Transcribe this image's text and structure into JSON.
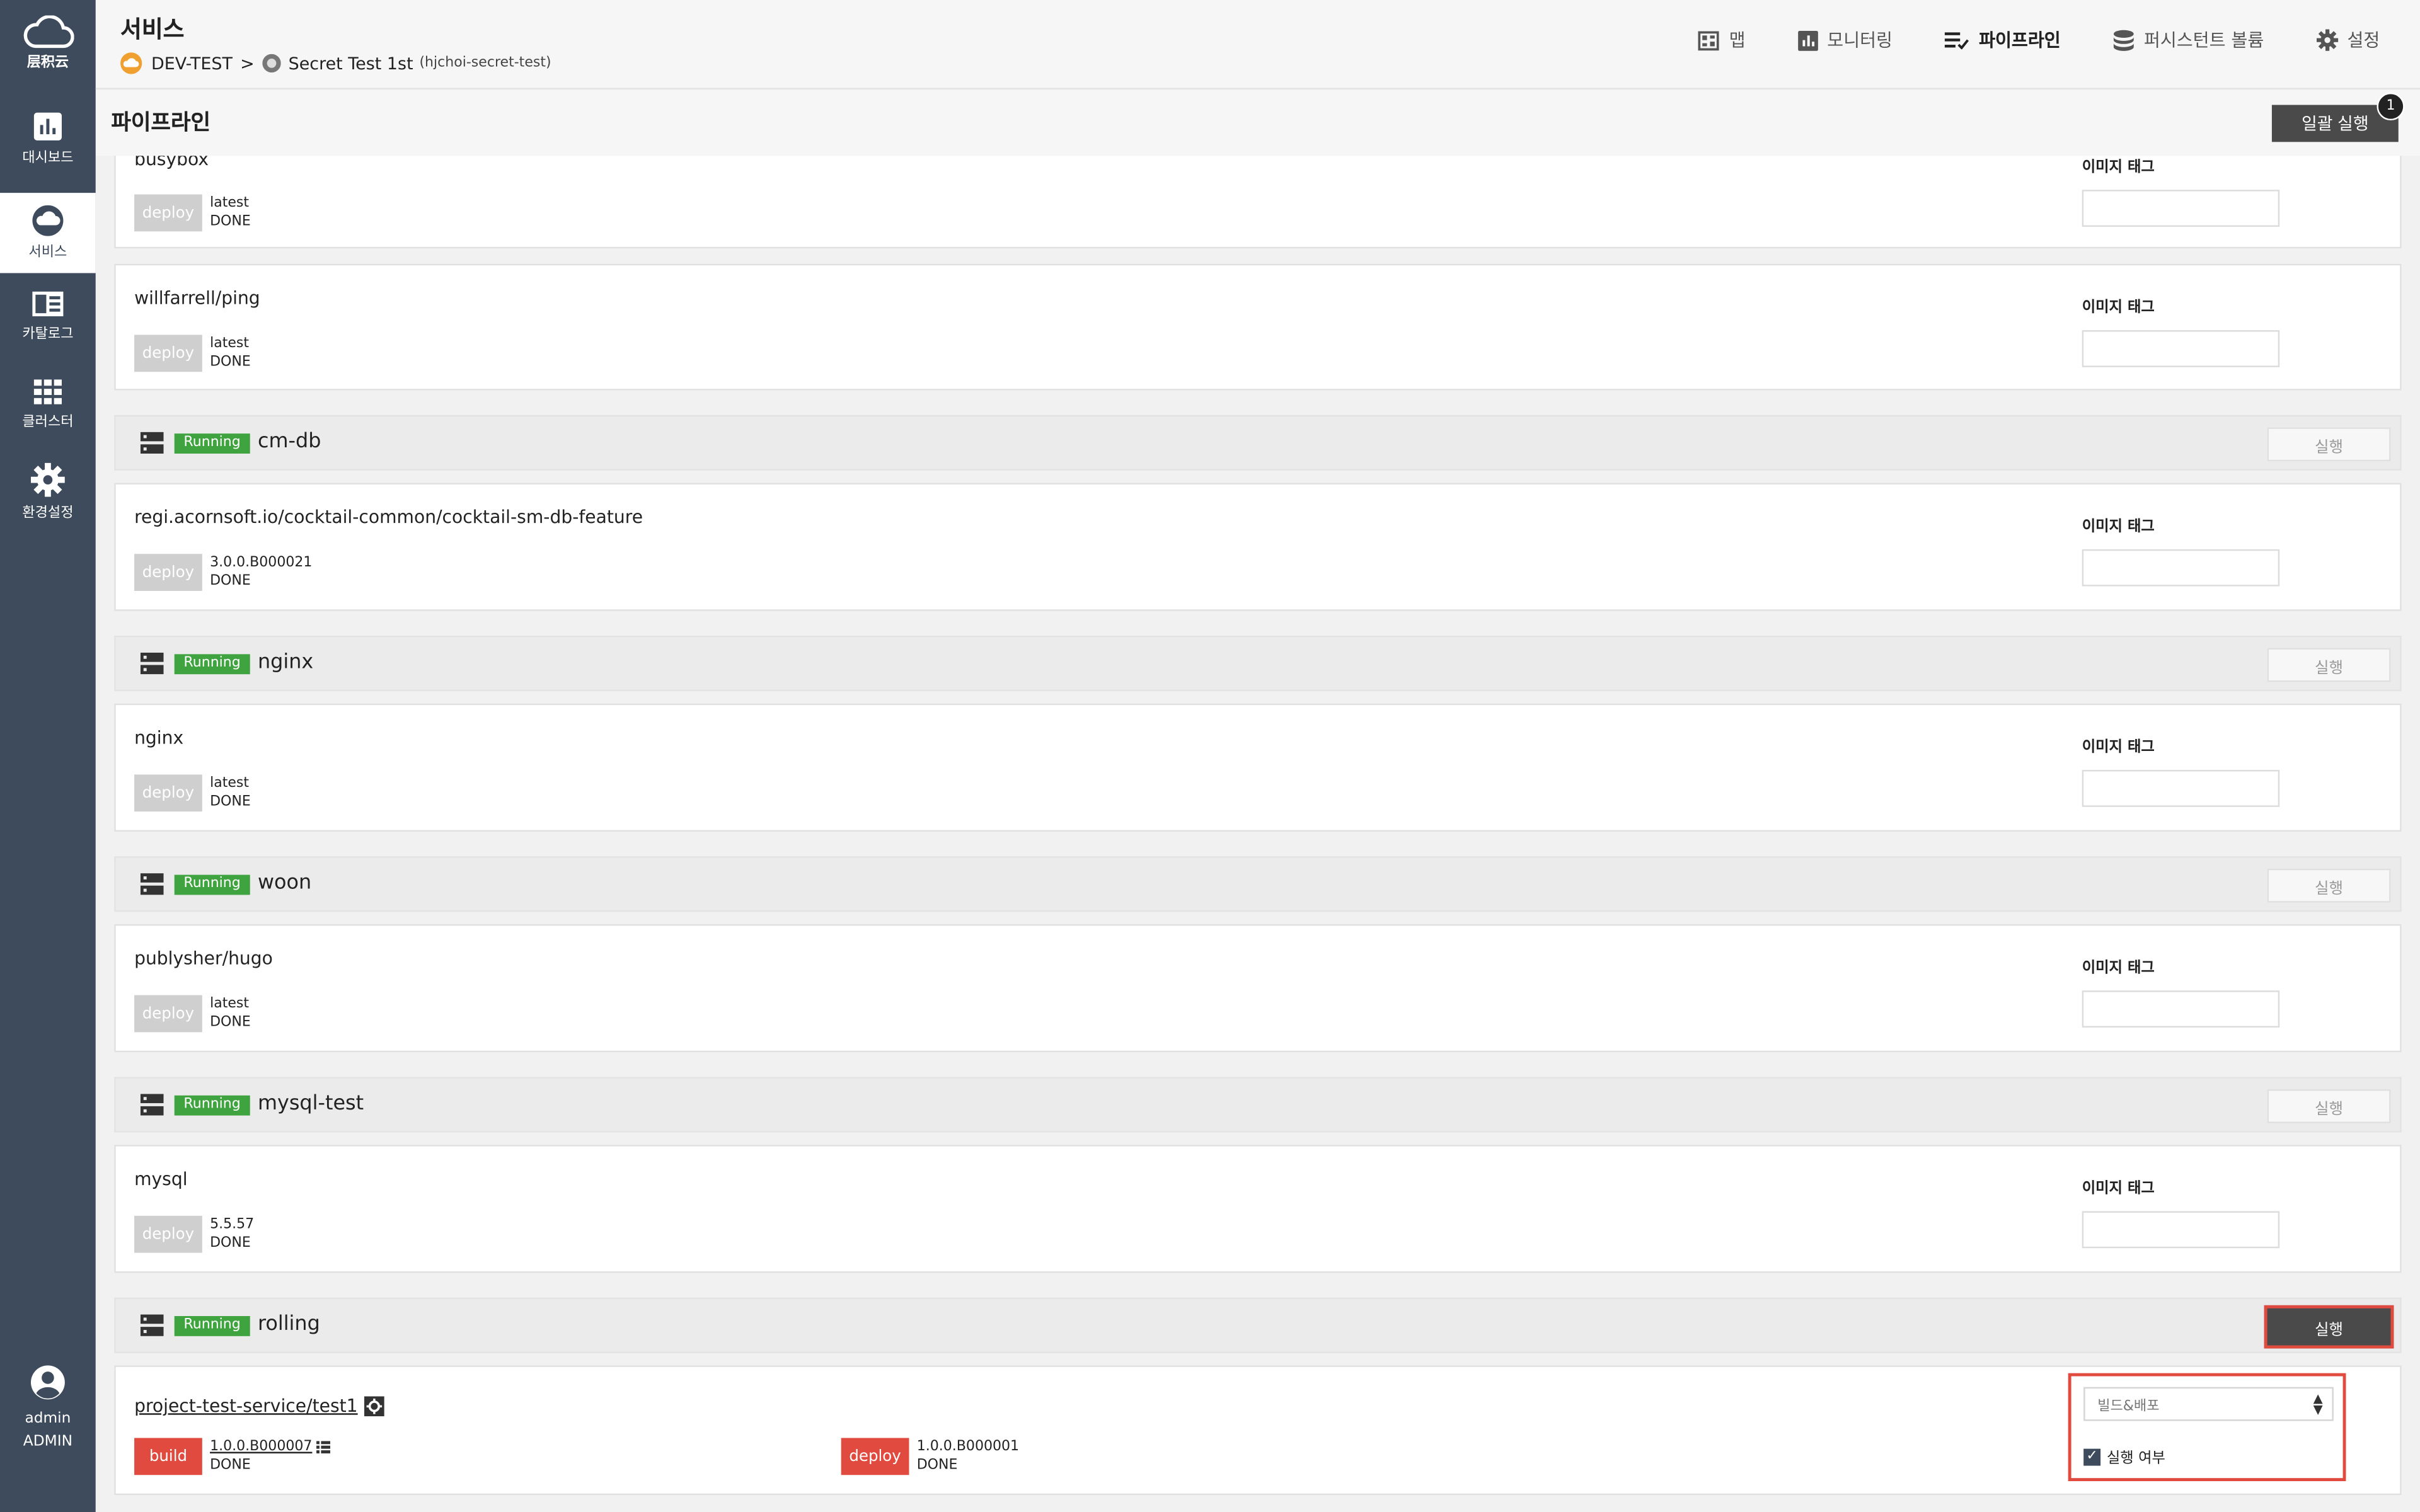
{
  "sidebar": {
    "logo_text": "层积云",
    "items": [
      {
        "label": "대시보드",
        "icon": "bar-chart-icon"
      },
      {
        "label": "서비스",
        "icon": "cloud-icon",
        "active": true
      },
      {
        "label": "카탈로그",
        "icon": "catalog-icon"
      },
      {
        "label": "클러스터",
        "icon": "grid-icon"
      },
      {
        "label": "환경설정",
        "icon": "gear-icon"
      }
    ],
    "user": {
      "name": "admin",
      "role": "ADMIN"
    }
  },
  "header": {
    "title": "서비스",
    "breadcrumb": {
      "env": "DEV-TEST",
      "sep": ">",
      "service": "Secret Test 1st",
      "service_id": "(hjchoi-secret-test)"
    },
    "nav": [
      {
        "label": "맵",
        "icon": "map-icon"
      },
      {
        "label": "모니터링",
        "icon": "monitoring-icon"
      },
      {
        "label": "파이프라인",
        "icon": "pipeline-icon",
        "active": true
      },
      {
        "label": "퍼시스턴트 볼륨",
        "icon": "database-icon"
      },
      {
        "label": "설정",
        "icon": "settings-icon"
      }
    ]
  },
  "subheader": {
    "title": "파이프라인",
    "run_all_label": "일괄 실행",
    "badge_count": "1"
  },
  "labels": {
    "image_tag": "이미지 태그",
    "run": "실행",
    "deploy": "deploy",
    "build": "build",
    "done": "DONE"
  },
  "cards_top": [
    {
      "name": "busybox",
      "tag": "latest",
      "status": "DONE"
    },
    {
      "name": "willfarrell/ping",
      "tag": "latest",
      "status": "DONE"
    }
  ],
  "groups": [
    {
      "name": "cm-db",
      "status": "Running",
      "image": "regi.acornsoft.io/cocktail-common/cocktail-sm-db-feature",
      "tag": "3.0.0.B000021",
      "state": "DONE"
    },
    {
      "name": "nginx",
      "status": "Running",
      "image": "nginx",
      "tag": "latest",
      "state": "DONE"
    },
    {
      "name": "woon",
      "status": "Running",
      "image": "publysher/hugo",
      "tag": "latest",
      "state": "DONE"
    },
    {
      "name": "mysql-test",
      "status": "Running",
      "image": "mysql",
      "tag": "5.5.57",
      "state": "DONE"
    }
  ],
  "rolling": {
    "name": "rolling",
    "status": "Running",
    "image": "project-test-service/test1",
    "build_tag": "1.0.0.B000007",
    "build_state": "DONE",
    "deploy_tag": "1.0.0.B000001",
    "deploy_state": "DONE",
    "select_value": "빌드&배포",
    "checkbox_label": "실행 여부",
    "checkbox_checked": true
  },
  "colors": {
    "sidebar": "#3d4b5c",
    "running": "#3fa33f",
    "accent": "#e04a3f",
    "dark_button": "#4a4a4a"
  }
}
